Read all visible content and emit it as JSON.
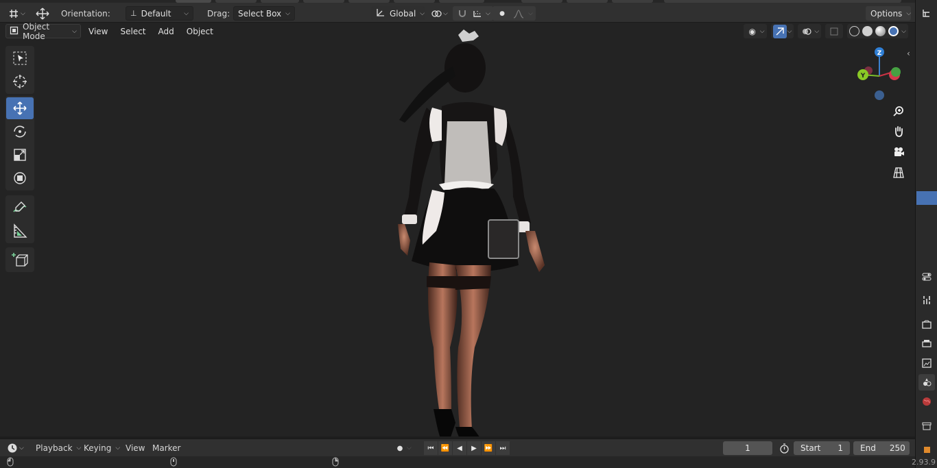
{
  "toolbar": {
    "orientation_label": "Orientation:",
    "orientation_value": "Default",
    "drag_label": "Drag:",
    "drag_value": "Select Box",
    "transform_orientation": "Global",
    "options_label": "Options"
  },
  "viewport_header": {
    "mode": "Object Mode",
    "menus": [
      "View",
      "Select",
      "Add",
      "Object"
    ]
  },
  "gizmo": {
    "z": "Z",
    "y": "Y"
  },
  "timeline": {
    "menus": [
      "Playback",
      "Keying",
      "View",
      "Marker"
    ],
    "current_frame": "1",
    "start_label": "Start",
    "start_value": "1",
    "end_label": "End",
    "end_value": "250"
  },
  "status": {
    "version": "2.93.9"
  },
  "colors": {
    "accent": "#4772b3",
    "viewport_bg": "#232323",
    "header_bg": "#303030"
  }
}
